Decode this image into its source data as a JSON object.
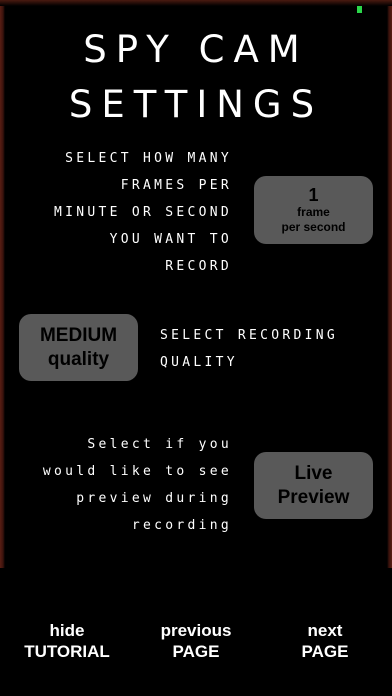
{
  "title": {
    "line1": "SPY CAM",
    "line2": "SETTINGS"
  },
  "frames_section": {
    "lines": [
      "SELECT HOW MANY",
      "FRAMES PER",
      "MINUTE OR SECOND",
      "YOU WANT TO",
      "RECORD"
    ],
    "button": {
      "value": "1",
      "unit_line1": "frame",
      "unit_line2": "per second"
    }
  },
  "quality_section": {
    "button": {
      "line1": "MEDIUM",
      "line2": "quality"
    },
    "lines": [
      "SELECT RECORDING",
      "QUALITY"
    ]
  },
  "preview_section": {
    "lines": [
      "Select if you",
      "would like to see",
      "preview during",
      "recording"
    ],
    "button": {
      "line1": "Live",
      "line2": "Preview"
    }
  },
  "footer": {
    "hide_tutorial": {
      "line1": "hide",
      "line2": "TUTORIAL"
    },
    "previous_page": {
      "line1": "previous",
      "line2": "PAGE"
    },
    "next_page": {
      "line1": "next",
      "line2": "PAGE"
    }
  },
  "colors": {
    "background": "#000000",
    "button_gray": "#595959",
    "status_indicator": "#2bd64a",
    "border_wood": "#5a1e14"
  }
}
